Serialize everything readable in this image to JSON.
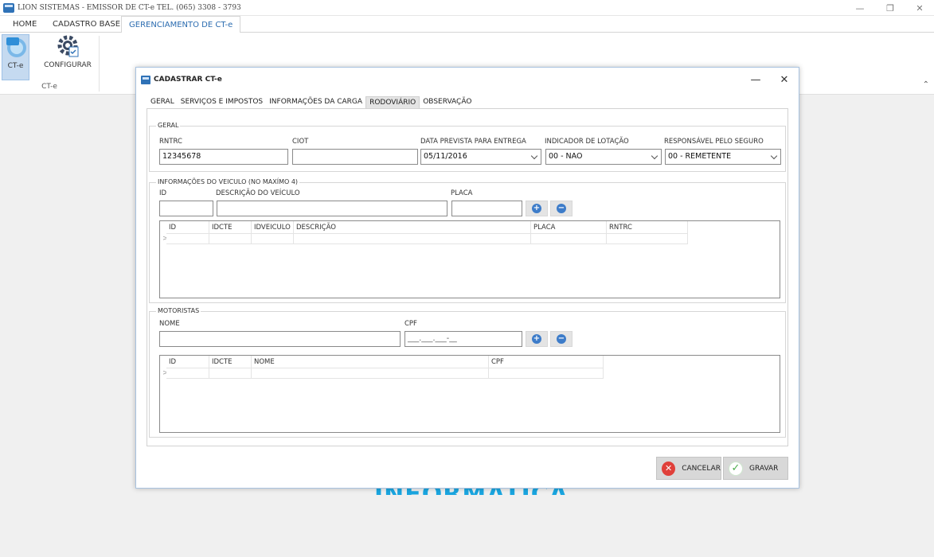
{
  "app": {
    "title": "LION SISTEMAS - EMISSOR DE CT-e  TEL. (065) 3308 - 3793",
    "window_controls": {
      "minimize": "—",
      "restore": "❐",
      "close": "✕"
    },
    "watermark": "INFORMÁTICA"
  },
  "ribbon": {
    "tabs": [
      "HOME",
      "CADASTRO BASE",
      "GERENCIAMENTO DE CT-e"
    ],
    "active_tab": "GERENCIAMENTO DE CT-e",
    "buttons": {
      "cte": "CT-e",
      "configurar": "CONFIGURAR"
    },
    "cte_icon_text": "CT",
    "group_label": "CT-e",
    "collapse": "⌃"
  },
  "dialog": {
    "title": "CADASTRAR  CT-e",
    "controls": {
      "minimize": "—",
      "close": "✕"
    },
    "tabs": [
      "GERAL",
      "SERVIÇOS E IMPOSTOS",
      "INFORMAÇÕES DA CARGA",
      "RODOVIÁRIO",
      "OBSERVAÇÃO"
    ],
    "active_tab": "RODOVIÁRIO",
    "geral": {
      "title": "GERAL",
      "rntrc_label": "RNTRC",
      "rntrc_value": "12345678",
      "ciot_label": "CIOT",
      "ciot_value": "",
      "data_label": "DATA PREVISTA PARA ENTREGA",
      "data_value": "05/11/2016",
      "lotacao_label": "INDICADOR DE LOTAÇÃO",
      "lotacao_value": "00 - NAO",
      "seguro_label": "RESPONSÁVEL PELO SEGURO",
      "seguro_value": "00 - REMETENTE"
    },
    "veiculo": {
      "title": "INFORMAÇÕES DO VEICULO (NO MAXÍMO 4)",
      "id_label": "ID",
      "descricao_label": "DESCRIÇÃO DO VEÍCULO",
      "placa_label": "PLACA",
      "add": "+",
      "remove": "−",
      "grid_columns": [
        "ID",
        "IDCTE",
        "IDVEICULO",
        "DESCRIÇÃO",
        "PLACA",
        "RNTRC"
      ],
      "row_marker": ">"
    },
    "motoristas": {
      "title": "MOTORISTAS",
      "nome_label": "NOME",
      "cpf_label": "CPF",
      "cpf_mask": "___.___.___-__",
      "add": "+",
      "remove": "−",
      "grid_columns": [
        "ID",
        "IDCTE",
        "NOME",
        "CPF"
      ],
      "row_marker": ">"
    },
    "actions": {
      "cancel": "CANCELAR",
      "cancel_icon": "✕",
      "save": "GRAVAR",
      "save_icon": "✓"
    }
  }
}
